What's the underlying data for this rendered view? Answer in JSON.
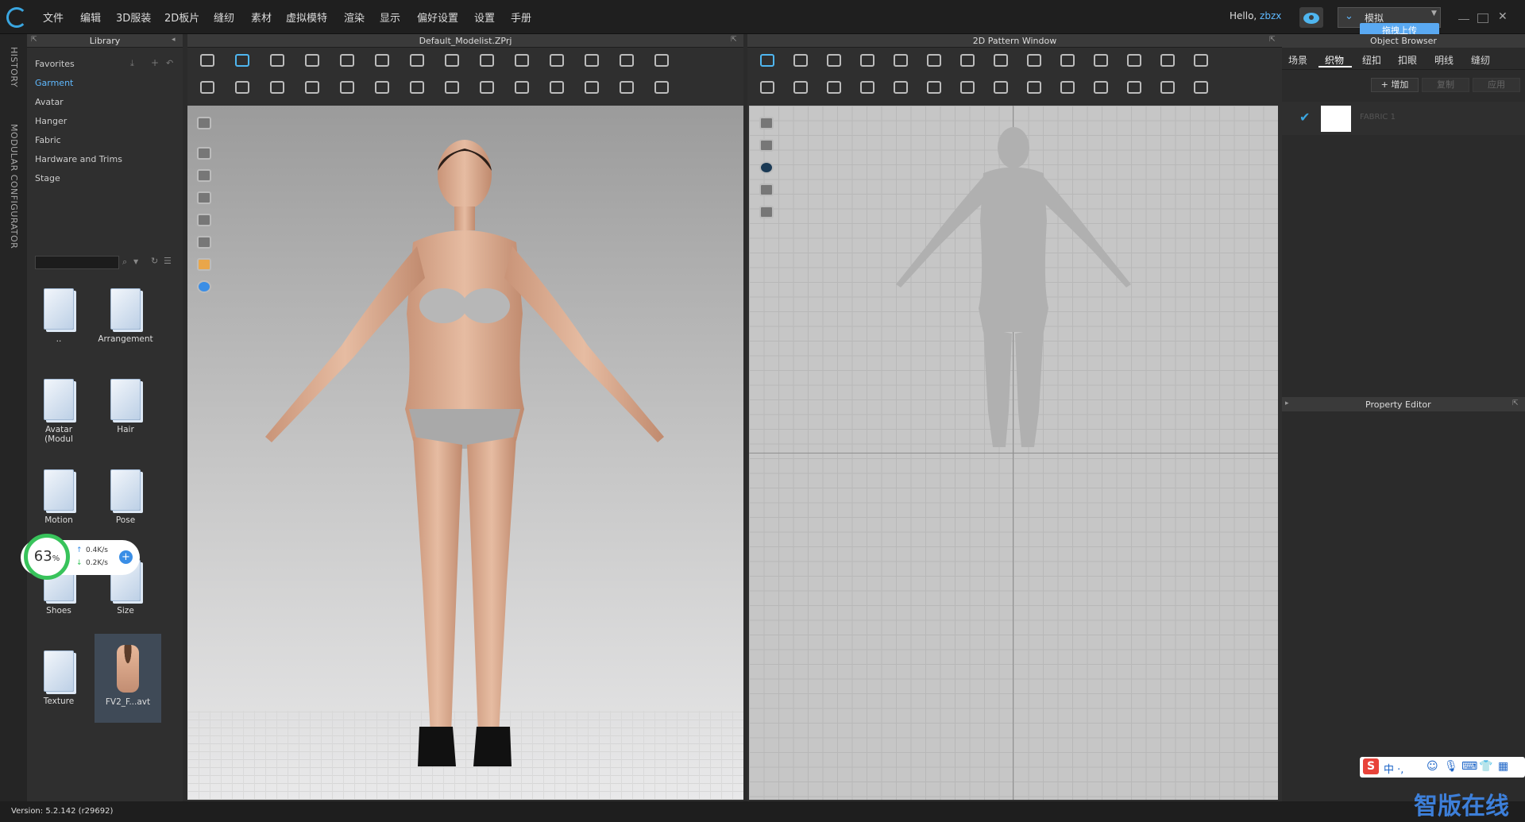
{
  "menubar": {
    "items": [
      "文件",
      "编辑",
      "3D服装",
      "2D板片",
      "缝纫",
      "素材",
      "虚拟模特",
      "渲染",
      "显示",
      "偏好设置",
      "设置",
      "手册"
    ],
    "hello_prefix": "Hello, ",
    "username": "zbzx",
    "mode_label": "模拟",
    "upload_label": "拖拽上传"
  },
  "left_strip": {
    "history_label": "HISTORY",
    "modular_label": "MODULAR CONFIGURATOR"
  },
  "library": {
    "title": "Library",
    "items": [
      {
        "label": "Favorites"
      },
      {
        "label": "Garment"
      },
      {
        "label": "Avatar"
      },
      {
        "label": "Hanger"
      },
      {
        "label": "Fabric"
      },
      {
        "label": "Hardware and Trims"
      },
      {
        "label": "Stage"
      }
    ],
    "selected_item": "Garment",
    "folders": [
      {
        "label": ".."
      },
      {
        "label": "Arrangement"
      },
      {
        "label": "Avatar (Modul"
      },
      {
        "label": "Hair"
      },
      {
        "label": "Motion"
      },
      {
        "label": "Pose"
      },
      {
        "label": "Shoes"
      },
      {
        "label": "Size"
      },
      {
        "label": "Texture"
      },
      {
        "label": "FV2_F...avt"
      }
    ]
  },
  "net_widget": {
    "percent": "63",
    "percent_unit": "%",
    "up": "0.4K/s",
    "down": "0.2K/s"
  },
  "viewport3d": {
    "title": "Default_Modelist.ZPrj"
  },
  "viewport2d": {
    "title": "2D Pattern Window"
  },
  "object_browser": {
    "title": "Object Browser",
    "tabs": [
      "场景",
      "织物",
      "纽扣",
      "扣眼",
      "明线",
      "缝纫"
    ],
    "active_tab": "织物",
    "actions": [
      "+ 增加",
      "复制",
      "应用"
    ],
    "fabric_name": "FABRIC 1"
  },
  "property_editor": {
    "title": "Property Editor"
  },
  "status": {
    "version": "Version: 5.2.142 (r29692)"
  },
  "watermark": {
    "text": "智版在线"
  },
  "ime": {
    "chars": "中 ·,"
  },
  "colors": {
    "accent": "#3aa6e0",
    "selected_text": "#5fb9ff",
    "canvas_2d": "#c6c6c6"
  }
}
